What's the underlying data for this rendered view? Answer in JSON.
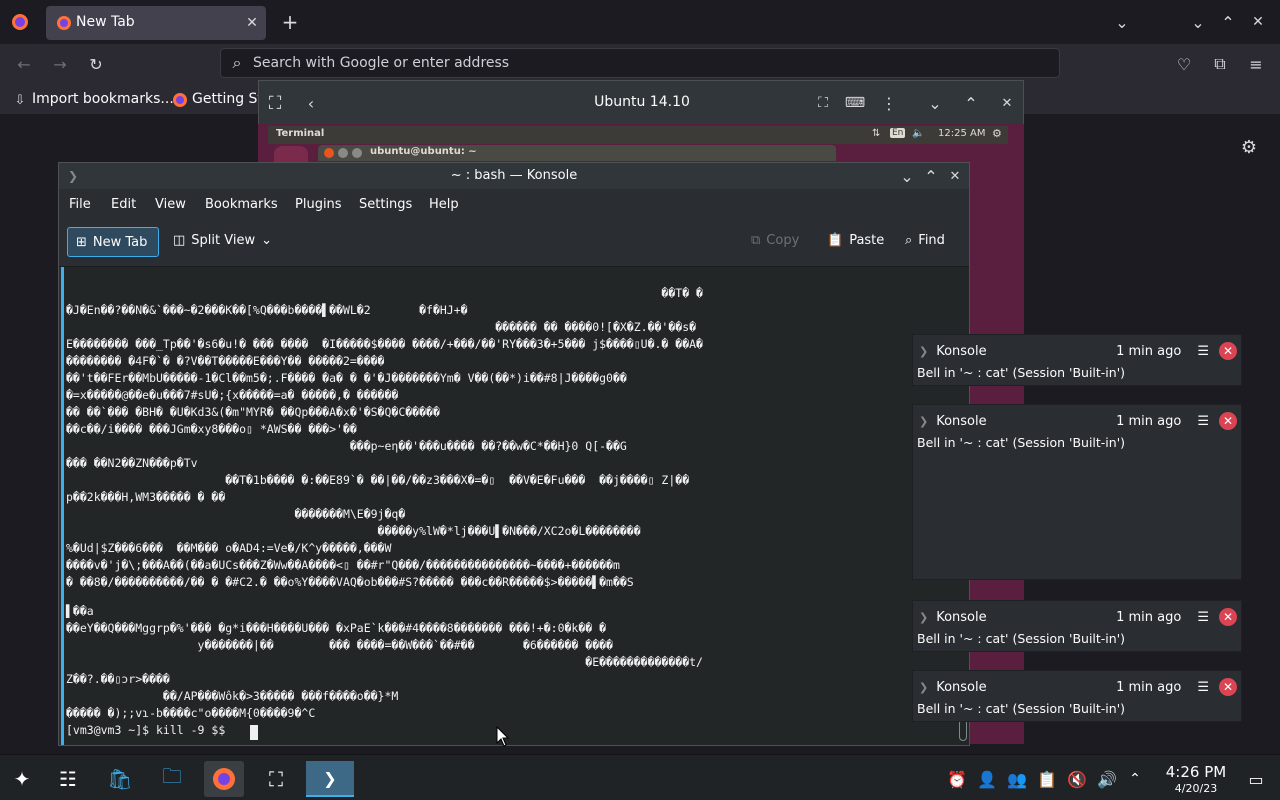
{
  "firefox": {
    "tab_title": "New Tab",
    "url_placeholder": "Search with Google or enter address",
    "bookmarks": [
      "Import bookmarks...",
      "Getting St"
    ]
  },
  "vm": {
    "title": "Ubuntu 14.10",
    "panel_title": "Terminal",
    "panel_lang": "En",
    "panel_time": "12:25 AM",
    "term_title": "ubuntu@ubuntu: ~"
  },
  "konsole": {
    "title": "~ : bash — Konsole",
    "menu": [
      "File",
      "Edit",
      "View",
      "Bookmarks",
      "Plugins",
      "Settings",
      "Help"
    ],
    "toolbar": {
      "new_tab": "New Tab",
      "split_view": "Split View",
      "copy": "Copy",
      "paste": "Paste",
      "find": "Find"
    },
    "terminal_lines": [
      "                                                                                      ��T� �",
      "�J�En��?��N�&`���~�2���K��[%Q���b����▌��WL�2       �f�HJ+�",
      "                                                              ������ �� ����0![�X�Z.��'��s�",
      "E�������� ���_Tp��'�s6�u!� ��� ����  �I�����$���� ����/+���/��'RY���3�+5��� j$����▯U�.� ��A�",
      "�������� �4F�`� �?V��T�����E���Y�� �����2=����",
      "��'t��FEr��MbU�����-1�Cl��m5�;.F���� �a� � �'�J�������Ym� V��(��*)i��#8|J����g0��",
      "�=x�����@��e�u���7#sU�;{x�����=a� �����,� ������",
      "�� ��`��� �BH� �U�Kd3&(�m\"MYR� ��Qp���A�x�'�S�Q�C�����",
      "��c��/i���� ���JGm�xy8���o▯ *AWS�� ���>'��",
      "                                         ���p~eη��'���u���� ��?��w�C*��H}0 Q[-��G",
      "��� ��N2��ZN���p�Tv",
      "                       ��T�1b���� �:��E89`� ��|��/��z3���X�=�▯  ��V�E�Fu���  ��j����▯ Z|��",
      "p��2k���H,WM3����� � ��",
      "                                 �������M\\E�9j�q�",
      "                                             �����y%lW�*lj���U▌�N���/XC2o�L��������",
      "%�Ud|$Z���6���  ��M��� o�AD4:=Ve�/K^y�����,���W",
      "����v�'j�\\;���A��(��a�UCs���Z�Ww��A����<▯ ��#r\"Q���/���������������~����+������m",
      "� ��8�/����������/�� � �#C2.� ��o%Y����VAQ�ob���#S?����� ���c��R�����$>�����▌�m��S",
      "▌��a",
      "��eY��Q���Mggrp�%'��� �g*i���H����U��� �xPaE`k���#4����8������� ���!+�:0�k�� �",
      "                   y�������|��        ��� ����=��W���`��#��       �6������ ����",
      "                                                                           �E�������������t/",
      "Z��?.��▯ɔr>����",
      "              ��/AP���Wôk�>3����� ���f����o��}*M",
      "����� �);;vɿ-b����c\"o����M{0����9�^C",
      "[vm3@vm3 ~]$ kill -9 $$"
    ]
  },
  "notifications": [
    {
      "app": "Konsole",
      "time": "1 min ago",
      "body": "Bell in '~ : cat' (Session 'Built-in')"
    },
    {
      "app": "Konsole",
      "time": "1 min ago",
      "body": "Bell in '~ : cat' (Session 'Built-in')"
    },
    {
      "app": "Konsole",
      "time": "1 min ago",
      "body": "Bell in '~ : cat' (Session 'Built-in')"
    },
    {
      "app": "Konsole",
      "time": "1 min ago",
      "body": "Bell in '~ : cat' (Session 'Built-in')"
    }
  ],
  "taskbar": {
    "time": "4:26 PM",
    "date": "4/20/23"
  },
  "colors": {
    "accent": "#3daee9",
    "close_red": "#da4453",
    "ubuntu_purple": "#5a1f3e"
  }
}
